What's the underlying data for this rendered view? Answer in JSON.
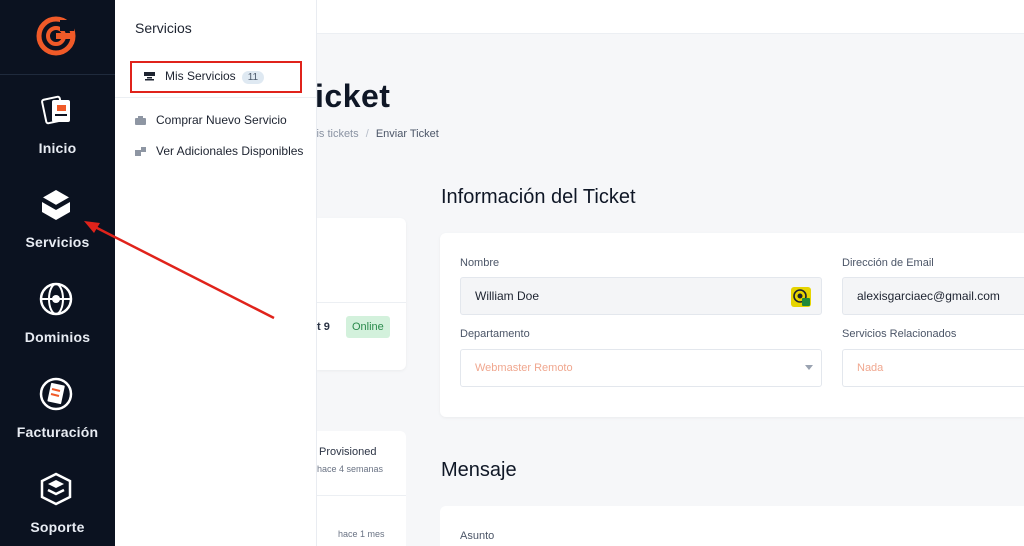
{
  "sidebar": {
    "logo": "brand-logo",
    "items": [
      {
        "label": "Inicio",
        "icon": "home-icon"
      },
      {
        "label": "Servicios",
        "icon": "box-icon"
      },
      {
        "label": "Dominios",
        "icon": "globe-icon"
      },
      {
        "label": "Facturación",
        "icon": "invoice-icon"
      },
      {
        "label": "Soporte",
        "icon": "support-icon"
      }
    ]
  },
  "submenu": {
    "title": "Servicios",
    "items": [
      {
        "label": "Mis Servicios",
        "badge": "11",
        "icon": "server-icon"
      },
      {
        "label": "Comprar Nuevo Servicio",
        "icon": "cart-icon"
      },
      {
        "label": "Ver Adicionales Disponibles",
        "icon": "addons-icon"
      }
    ]
  },
  "page": {
    "title_partial": "icket",
    "breadcrumb": {
      "prev": "lis tickets",
      "sep": "/",
      "current": "Enviar Ticket"
    }
  },
  "left_cards": {
    "card1_text": "t 9",
    "status": "Online",
    "card2_status": "Provisioned",
    "card2_time1": "hace 4 semanas",
    "card2_time2": "hace 1 mes"
  },
  "ticket_info": {
    "title": "Información del Ticket",
    "name_label": "Nombre",
    "name_value": "William Doe",
    "email_label": "Dirección de Email",
    "email_value": "alexisgarciaec@gmail.com",
    "department_label": "Departamento",
    "department_value": "Webmaster Remoto",
    "related_label": "Servicios Relacionados",
    "related_value": "Nada"
  },
  "message": {
    "title": "Mensaje",
    "subject_label": "Asunto"
  },
  "colors": {
    "sidebar_bg": "#0b1220",
    "accent": "#f05a28",
    "highlight": "#e0231b",
    "online_bg": "#d3f1dc"
  }
}
